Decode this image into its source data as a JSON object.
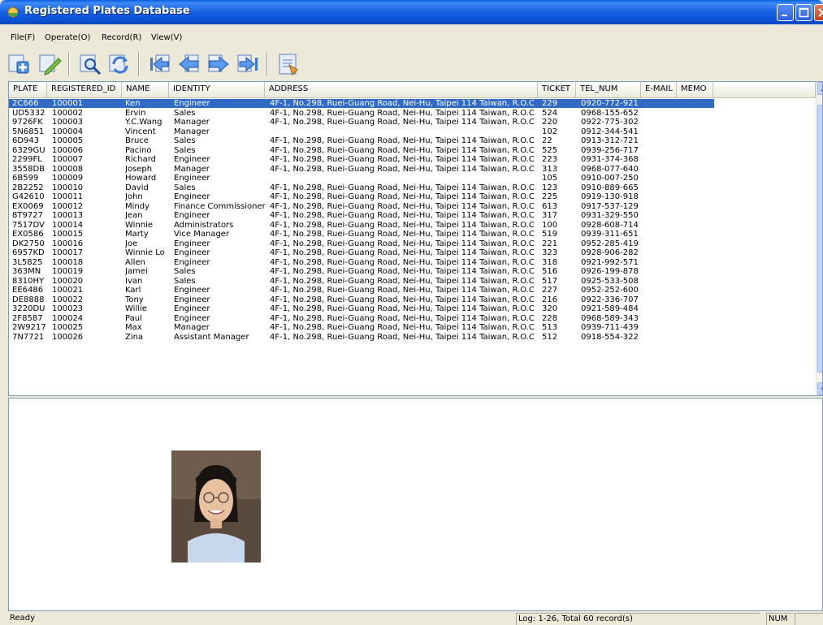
{
  "window": {
    "title": "Registered Plates Database"
  },
  "menu": {
    "items": [
      "File(F)",
      "Operate(O)",
      "Record(R)",
      "View(V)"
    ]
  },
  "toolbar": {
    "buttons": [
      "add-record-icon",
      "edit-record-icon",
      "search-icon",
      "refresh-icon",
      "first-record-icon",
      "previous-record-icon",
      "next-record-icon",
      "last-record-icon",
      "exit-icon"
    ]
  },
  "list": {
    "columns": [
      "PLATE",
      "REGISTERED_ID",
      "NAME",
      "IDENTITY",
      "ADDRESS",
      "TICKET",
      "TEL_NUM",
      "E-MAIL",
      "MEMO"
    ],
    "rows": [
      {
        "plate": "2C666",
        "rid": "100001",
        "name": "Ken",
        "identity": "Engineer",
        "address": "4F-1, No.298, Ruei-Guang Road, Nei-Hu, Taipei 114 Taiwan, R.O.C",
        "ticket": "229",
        "tel": "0920-772-921",
        "selected": true
      },
      {
        "plate": "UD5332",
        "rid": "100002",
        "name": "Ervin",
        "identity": "Sales",
        "address": "4F-1, No.298, Ruei-Guang Road, Nei-Hu, Taipei 114 Taiwan, R.O.C",
        "ticket": "524",
        "tel": "0968-155-652"
      },
      {
        "plate": "9726FK",
        "rid": "100003",
        "name": "Y.C.Wang",
        "identity": "Manager",
        "address": "4F-1, No.298, Ruei-Guang Road, Nei-Hu, Taipei 114 Taiwan, R.O.C",
        "ticket": "220",
        "tel": "0922-775-302"
      },
      {
        "plate": "5N6851",
        "rid": "100004",
        "name": "Vincent",
        "identity": "Manager",
        "address": "",
        "ticket": "102",
        "tel": "0912-344-541"
      },
      {
        "plate": "6D943",
        "rid": "100005",
        "name": "Bruce",
        "identity": "Sales",
        "address": "4F-1, No.298, Ruei-Guang Road, Nei-Hu, Taipei 114 Taiwan, R.O.C",
        "ticket": "22",
        "tel": "0913-312-721"
      },
      {
        "plate": "6329GU",
        "rid": "100006",
        "name": "Pacino",
        "identity": "Sales",
        "address": "4F-1, No.298, Ruei-Guang Road, Nei-Hu, Taipei 114 Taiwan, R.O.C",
        "ticket": "525",
        "tel": "0939-256-717"
      },
      {
        "plate": "2299FL",
        "rid": "100007",
        "name": "Richard",
        "identity": "Engineer",
        "address": "4F-1, No.298, Ruei-Guang Road, Nei-Hu, Taipei 114 Taiwan, R.O.C",
        "ticket": "223",
        "tel": "0931-374-368"
      },
      {
        "plate": "3558DB",
        "rid": "100008",
        "name": "Joseph",
        "identity": "Manager",
        "address": "4F-1, No.298, Ruei-Guang Road, Nei-Hu, Taipei 114 Taiwan, R.O.C",
        "ticket": "313",
        "tel": "0968-077-640"
      },
      {
        "plate": "6B599",
        "rid": "100009",
        "name": "Howard",
        "identity": "Engineer",
        "address": "",
        "ticket": "105",
        "tel": "0910-007-250"
      },
      {
        "plate": "2B2252",
        "rid": "100010",
        "name": "David",
        "identity": "Sales",
        "address": "4F-1, No.298, Ruei-Guang Road, Nei-Hu, Taipei 114 Taiwan, R.O.C",
        "ticket": "123",
        "tel": "0910-889-665"
      },
      {
        "plate": "G42610",
        "rid": "100011",
        "name": "John",
        "identity": "Engineer",
        "address": "4F-1, No.298, Ruei-Guang Road, Nei-Hu, Taipei 114 Taiwan, R.O.C",
        "ticket": "225",
        "tel": "0919-130-918"
      },
      {
        "plate": "EX0069",
        "rid": "100012",
        "name": "Mindy",
        "identity": "Finance Commissioner",
        "address": "4F-1, No.298, Ruei-Guang Road, Nei-Hu, Taipei 114 Taiwan, R.O.C",
        "ticket": "613",
        "tel": "0917-537-129"
      },
      {
        "plate": "8T9727",
        "rid": "100013",
        "name": "Jean",
        "identity": "Engineer",
        "address": "4F-1, No.298, Ruei-Guang Road, Nei-Hu, Taipei 114 Taiwan, R.O.C",
        "ticket": "317",
        "tel": "0931-329-550"
      },
      {
        "plate": "7517DV",
        "rid": "100014",
        "name": "Winnie",
        "identity": "Administrators",
        "address": "4F-1, No.298, Ruei-Guang Road, Nei-Hu, Taipei 114 Taiwan, R.O.C",
        "ticket": "100",
        "tel": "0928-608-714"
      },
      {
        "plate": "EX0586",
        "rid": "100015",
        "name": "Marty",
        "identity": "Vice Manager",
        "address": "4F-1, No.298, Ruei-Guang Road, Nei-Hu, Taipei 114 Taiwan, R.O.C",
        "ticket": "519",
        "tel": "0939-311-651"
      },
      {
        "plate": "DK2750",
        "rid": "100016",
        "name": "Joe",
        "identity": "Engineer",
        "address": "4F-1, No.298, Ruei-Guang Road, Nei-Hu, Taipei 114 Taiwan, R.O.C",
        "ticket": "221",
        "tel": "0952-285-419"
      },
      {
        "plate": "6957KD",
        "rid": "100017",
        "name": "Winnie Lo",
        "identity": "Engineer",
        "address": "4F-1, No.298, Ruei-Guang Road, Nei-Hu, Taipei 114 Taiwan, R.O.C",
        "ticket": "323",
        "tel": "0928-906-282"
      },
      {
        "plate": "3L5825",
        "rid": "100018",
        "name": "Allen",
        "identity": "Engineer",
        "address": "4F-1, No.298, Ruei-Guang Road, Nei-Hu, Taipei 114 Taiwan, R.O.C",
        "ticket": "318",
        "tel": "0921-992-571"
      },
      {
        "plate": "363MN",
        "rid": "100019",
        "name": "Jamei",
        "identity": "Sales",
        "address": "4F-1, No.298, Ruei-Guang Road, Nei-Hu, Taipei 114 Taiwan, R.O.C",
        "ticket": "516",
        "tel": "0926-199-878"
      },
      {
        "plate": "8310HY",
        "rid": "100020",
        "name": "Ivan",
        "identity": "Sales",
        "address": "4F-1, No.298, Ruei-Guang Road, Nei-Hu, Taipei 114 Taiwan, R.O.C",
        "ticket": "517",
        "tel": "0925-533-508"
      },
      {
        "plate": "EE6486",
        "rid": "100021",
        "name": "Karl",
        "identity": "Engineer",
        "address": "4F-1, No.298, Ruei-Guang Road, Nei-Hu, Taipei 114 Taiwan, R.O.C",
        "ticket": "227",
        "tel": "0952-252-600"
      },
      {
        "plate": "DE8888",
        "rid": "100022",
        "name": "Tony",
        "identity": "Engineer",
        "address": "4F-1, No.298, Ruei-Guang Road, Nei-Hu, Taipei 114 Taiwan, R.O.C",
        "ticket": "216",
        "tel": "0922-336-707"
      },
      {
        "plate": "3220DU",
        "rid": "100023",
        "name": "Willie",
        "identity": "Engineer",
        "address": "4F-1, No.298, Ruei-Guang Road, Nei-Hu, Taipei 114 Taiwan, R.O.C",
        "ticket": "320",
        "tel": "0921-589-484"
      },
      {
        "plate": "2F8587",
        "rid": "100024",
        "name": "Paul",
        "identity": "Engineer",
        "address": "4F-1, No.298, Ruei-Guang Road, Nei-Hu, Taipei 114 Taiwan, R.O.C",
        "ticket": "228",
        "tel": "0968-589-343"
      },
      {
        "plate": "2W9217",
        "rid": "100025",
        "name": "Max",
        "identity": "Manager",
        "address": "4F-1, No.298, Ruei-Guang Road, Nei-Hu, Taipei 114 Taiwan, R.O.C",
        "ticket": "513",
        "tel": "0939-711-439"
      },
      {
        "plate": "7N7721",
        "rid": "100026",
        "name": "Zina",
        "identity": "Assistant Manager",
        "address": "4F-1, No.298, Ruei-Guang Road, Nei-Hu, Taipei 114 Taiwan, R.O.C",
        "ticket": "512",
        "tel": "0918-554-322"
      }
    ]
  },
  "status": {
    "ready": "Ready",
    "log": "Log: 1-26, Total 60 record(s)",
    "num": "NUM"
  },
  "colors": {
    "selection": "#316ac5",
    "titlebar": "#0a52d8",
    "chrome": "#ece9d8"
  }
}
